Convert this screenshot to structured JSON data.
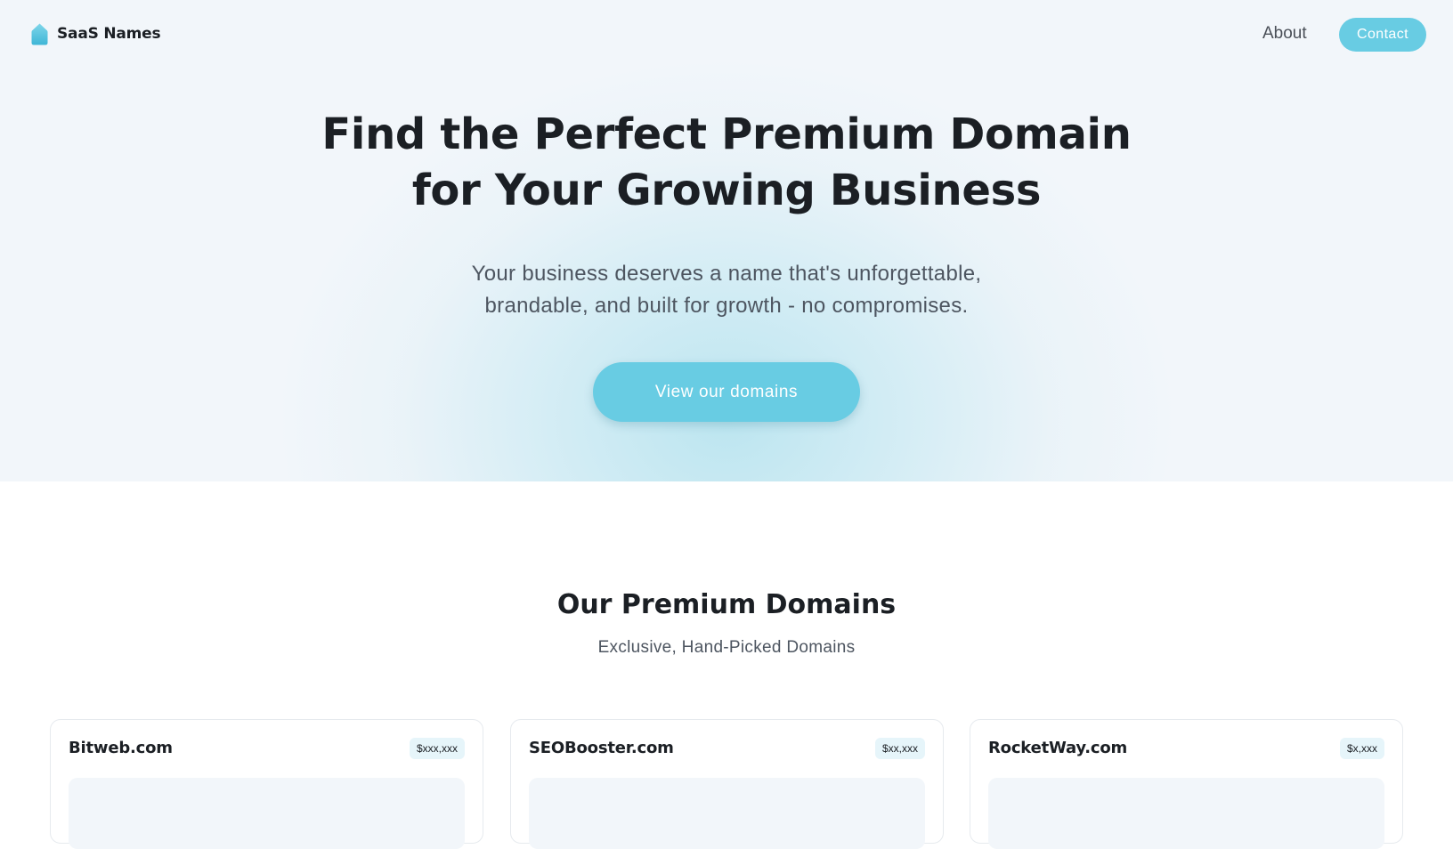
{
  "nav": {
    "brand_name": "SaaS Names",
    "brand_icon": "tag-icon",
    "about_label": "About",
    "contact_label": "Contact"
  },
  "hero": {
    "title_line1": "Find the Perfect Premium Domain",
    "title_line2": "for Your Growing Business",
    "subtitle_line1": "Your business deserves a name that's unforgettable,",
    "subtitle_line2": "brandable, and built for growth - no compromises.",
    "cta_label": "View our domains"
  },
  "domains": {
    "title": "Our Premium Domains",
    "subtitle": "Exclusive, Hand-Picked Domains",
    "items": [
      {
        "name": "Bitweb.com",
        "price": "$xxx,xxx"
      },
      {
        "name": "SEOBooster.com",
        "price": "$xx,xxx"
      },
      {
        "name": "RocketWay.com",
        "price": "$x,xxx"
      }
    ]
  },
  "colors": {
    "accent": "#68cce3",
    "hero_background": "#f2f6fa",
    "text_primary": "#1b1f24",
    "text_secondary": "#4d5560",
    "badge_background": "#e6f5fa"
  }
}
